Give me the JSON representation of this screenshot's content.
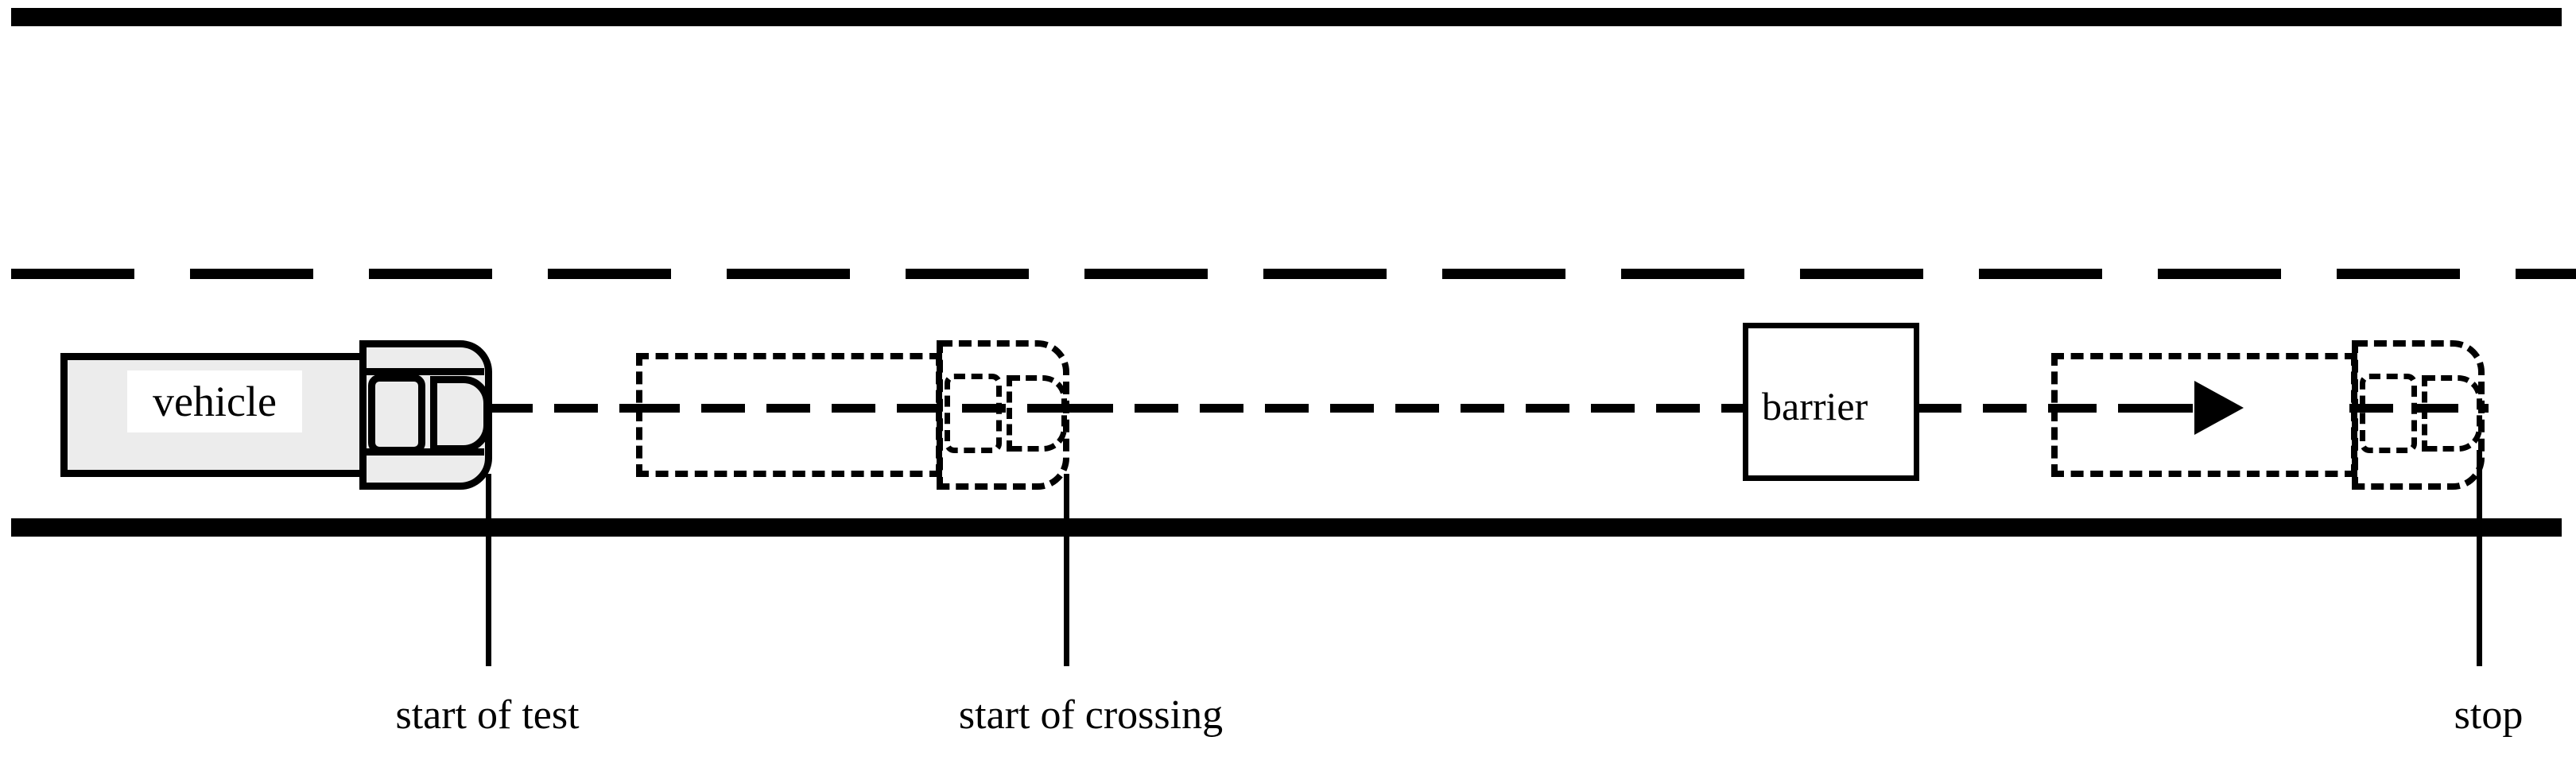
{
  "diagram": {
    "title": "vehicle crossing test track schematic",
    "colors": {
      "line": "#000000",
      "vehicle_fill": "#ececec",
      "background": "#ffffff"
    }
  },
  "road": {
    "top_edge_name": "road-edge-top",
    "bottom_edge_name": "road-edge-bottom",
    "lane_divider_name": "lane-divider",
    "centre_axis_name": "centre-axis"
  },
  "vehicles": [
    {
      "id": "vehicle-1",
      "style": "solid",
      "label": "vehicle",
      "state": "start"
    },
    {
      "id": "vehicle-2",
      "style": "dashed",
      "label": "",
      "state": "crossing"
    },
    {
      "id": "vehicle-3",
      "style": "dashed",
      "label": "",
      "state": "stop"
    }
  ],
  "barrier": {
    "label": "barrier"
  },
  "markers": [
    {
      "id": "marker-start-of-test",
      "label": "start of test"
    },
    {
      "id": "marker-start-of-crossing",
      "label": "start of crossing"
    },
    {
      "id": "marker-stop",
      "label": "stop"
    }
  ],
  "arrow": {
    "name": "direction-arrow",
    "direction": "right"
  }
}
